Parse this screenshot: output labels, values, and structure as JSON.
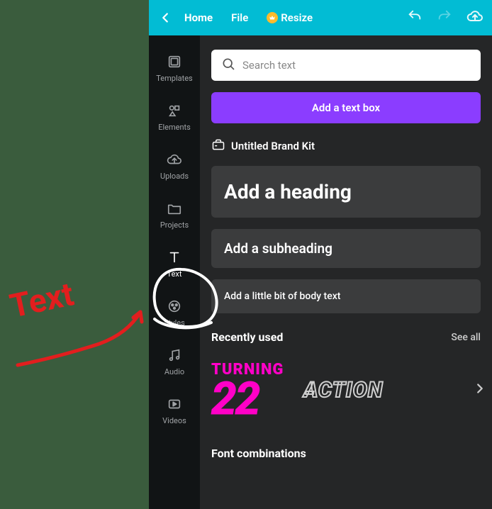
{
  "topbar": {
    "home": "Home",
    "file": "File",
    "resize": "Resize"
  },
  "sidebar": {
    "items": [
      {
        "label": "Templates"
      },
      {
        "label": "Elements"
      },
      {
        "label": "Uploads"
      },
      {
        "label": "Projects"
      },
      {
        "label": "Text"
      },
      {
        "label": "Styles"
      },
      {
        "label": "Audio"
      },
      {
        "label": "Videos"
      }
    ]
  },
  "panel": {
    "searchPlaceholder": "Search text",
    "addTextBox": "Add a text box",
    "brandKit": "Untitled Brand Kit",
    "heading": "Add a heading",
    "subheading": "Add a subheading",
    "body": "Add a little bit of body text",
    "recentlyUsed": "Recently used",
    "seeAll": "See all",
    "fontCombinations": "Font combinations",
    "recent1_top": "TURNING",
    "recent1_num": "22",
    "recent2": "ACTION"
  },
  "annotation": {
    "label": "Text"
  }
}
